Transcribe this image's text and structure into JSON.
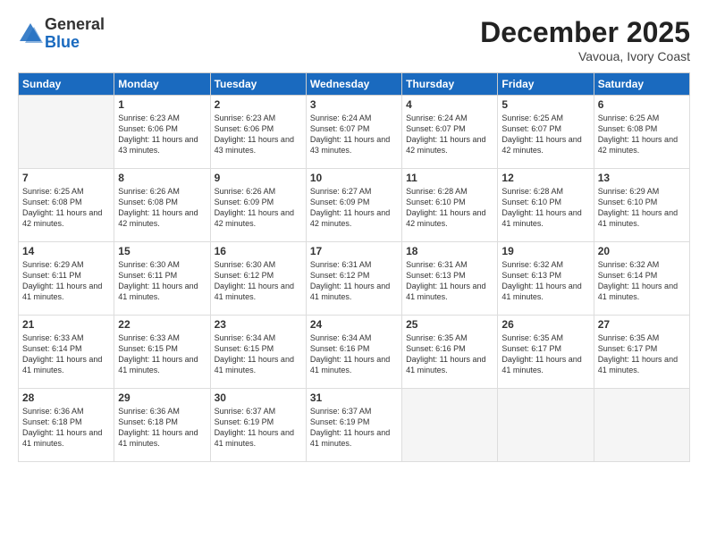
{
  "logo": {
    "general": "General",
    "blue": "Blue"
  },
  "title": "December 2025",
  "subtitle": "Vavoua, Ivory Coast",
  "headers": [
    "Sunday",
    "Monday",
    "Tuesday",
    "Wednesday",
    "Thursday",
    "Friday",
    "Saturday"
  ],
  "weeks": [
    [
      {
        "day": "",
        "sunrise": "",
        "sunset": "",
        "daylight": "",
        "empty": true
      },
      {
        "day": "1",
        "sunrise": "Sunrise: 6:23 AM",
        "sunset": "Sunset: 6:06 PM",
        "daylight": "Daylight: 11 hours and 43 minutes.",
        "empty": false
      },
      {
        "day": "2",
        "sunrise": "Sunrise: 6:23 AM",
        "sunset": "Sunset: 6:06 PM",
        "daylight": "Daylight: 11 hours and 43 minutes.",
        "empty": false
      },
      {
        "day": "3",
        "sunrise": "Sunrise: 6:24 AM",
        "sunset": "Sunset: 6:07 PM",
        "daylight": "Daylight: 11 hours and 43 minutes.",
        "empty": false
      },
      {
        "day": "4",
        "sunrise": "Sunrise: 6:24 AM",
        "sunset": "Sunset: 6:07 PM",
        "daylight": "Daylight: 11 hours and 42 minutes.",
        "empty": false
      },
      {
        "day": "5",
        "sunrise": "Sunrise: 6:25 AM",
        "sunset": "Sunset: 6:07 PM",
        "daylight": "Daylight: 11 hours and 42 minutes.",
        "empty": false
      },
      {
        "day": "6",
        "sunrise": "Sunrise: 6:25 AM",
        "sunset": "Sunset: 6:08 PM",
        "daylight": "Daylight: 11 hours and 42 minutes.",
        "empty": false
      }
    ],
    [
      {
        "day": "7",
        "sunrise": "Sunrise: 6:25 AM",
        "sunset": "Sunset: 6:08 PM",
        "daylight": "Daylight: 11 hours and 42 minutes.",
        "empty": false
      },
      {
        "day": "8",
        "sunrise": "Sunrise: 6:26 AM",
        "sunset": "Sunset: 6:08 PM",
        "daylight": "Daylight: 11 hours and 42 minutes.",
        "empty": false
      },
      {
        "day": "9",
        "sunrise": "Sunrise: 6:26 AM",
        "sunset": "Sunset: 6:09 PM",
        "daylight": "Daylight: 11 hours and 42 minutes.",
        "empty": false
      },
      {
        "day": "10",
        "sunrise": "Sunrise: 6:27 AM",
        "sunset": "Sunset: 6:09 PM",
        "daylight": "Daylight: 11 hours and 42 minutes.",
        "empty": false
      },
      {
        "day": "11",
        "sunrise": "Sunrise: 6:28 AM",
        "sunset": "Sunset: 6:10 PM",
        "daylight": "Daylight: 11 hours and 42 minutes.",
        "empty": false
      },
      {
        "day": "12",
        "sunrise": "Sunrise: 6:28 AM",
        "sunset": "Sunset: 6:10 PM",
        "daylight": "Daylight: 11 hours and 41 minutes.",
        "empty": false
      },
      {
        "day": "13",
        "sunrise": "Sunrise: 6:29 AM",
        "sunset": "Sunset: 6:10 PM",
        "daylight": "Daylight: 11 hours and 41 minutes.",
        "empty": false
      }
    ],
    [
      {
        "day": "14",
        "sunrise": "Sunrise: 6:29 AM",
        "sunset": "Sunset: 6:11 PM",
        "daylight": "Daylight: 11 hours and 41 minutes.",
        "empty": false
      },
      {
        "day": "15",
        "sunrise": "Sunrise: 6:30 AM",
        "sunset": "Sunset: 6:11 PM",
        "daylight": "Daylight: 11 hours and 41 minutes.",
        "empty": false
      },
      {
        "day": "16",
        "sunrise": "Sunrise: 6:30 AM",
        "sunset": "Sunset: 6:12 PM",
        "daylight": "Daylight: 11 hours and 41 minutes.",
        "empty": false
      },
      {
        "day": "17",
        "sunrise": "Sunrise: 6:31 AM",
        "sunset": "Sunset: 6:12 PM",
        "daylight": "Daylight: 11 hours and 41 minutes.",
        "empty": false
      },
      {
        "day": "18",
        "sunrise": "Sunrise: 6:31 AM",
        "sunset": "Sunset: 6:13 PM",
        "daylight": "Daylight: 11 hours and 41 minutes.",
        "empty": false
      },
      {
        "day": "19",
        "sunrise": "Sunrise: 6:32 AM",
        "sunset": "Sunset: 6:13 PM",
        "daylight": "Daylight: 11 hours and 41 minutes.",
        "empty": false
      },
      {
        "day": "20",
        "sunrise": "Sunrise: 6:32 AM",
        "sunset": "Sunset: 6:14 PM",
        "daylight": "Daylight: 11 hours and 41 minutes.",
        "empty": false
      }
    ],
    [
      {
        "day": "21",
        "sunrise": "Sunrise: 6:33 AM",
        "sunset": "Sunset: 6:14 PM",
        "daylight": "Daylight: 11 hours and 41 minutes.",
        "empty": false
      },
      {
        "day": "22",
        "sunrise": "Sunrise: 6:33 AM",
        "sunset": "Sunset: 6:15 PM",
        "daylight": "Daylight: 11 hours and 41 minutes.",
        "empty": false
      },
      {
        "day": "23",
        "sunrise": "Sunrise: 6:34 AM",
        "sunset": "Sunset: 6:15 PM",
        "daylight": "Daylight: 11 hours and 41 minutes.",
        "empty": false
      },
      {
        "day": "24",
        "sunrise": "Sunrise: 6:34 AM",
        "sunset": "Sunset: 6:16 PM",
        "daylight": "Daylight: 11 hours and 41 minutes.",
        "empty": false
      },
      {
        "day": "25",
        "sunrise": "Sunrise: 6:35 AM",
        "sunset": "Sunset: 6:16 PM",
        "daylight": "Daylight: 11 hours and 41 minutes.",
        "empty": false
      },
      {
        "day": "26",
        "sunrise": "Sunrise: 6:35 AM",
        "sunset": "Sunset: 6:17 PM",
        "daylight": "Daylight: 11 hours and 41 minutes.",
        "empty": false
      },
      {
        "day": "27",
        "sunrise": "Sunrise: 6:35 AM",
        "sunset": "Sunset: 6:17 PM",
        "daylight": "Daylight: 11 hours and 41 minutes.",
        "empty": false
      }
    ],
    [
      {
        "day": "28",
        "sunrise": "Sunrise: 6:36 AM",
        "sunset": "Sunset: 6:18 PM",
        "daylight": "Daylight: 11 hours and 41 minutes.",
        "empty": false
      },
      {
        "day": "29",
        "sunrise": "Sunrise: 6:36 AM",
        "sunset": "Sunset: 6:18 PM",
        "daylight": "Daylight: 11 hours and 41 minutes.",
        "empty": false
      },
      {
        "day": "30",
        "sunrise": "Sunrise: 6:37 AM",
        "sunset": "Sunset: 6:19 PM",
        "daylight": "Daylight: 11 hours and 41 minutes.",
        "empty": false
      },
      {
        "day": "31",
        "sunrise": "Sunrise: 6:37 AM",
        "sunset": "Sunset: 6:19 PM",
        "daylight": "Daylight: 11 hours and 41 minutes.",
        "empty": false
      },
      {
        "day": "",
        "sunrise": "",
        "sunset": "",
        "daylight": "",
        "empty": true
      },
      {
        "day": "",
        "sunrise": "",
        "sunset": "",
        "daylight": "",
        "empty": true
      },
      {
        "day": "",
        "sunrise": "",
        "sunset": "",
        "daylight": "",
        "empty": true
      }
    ]
  ]
}
